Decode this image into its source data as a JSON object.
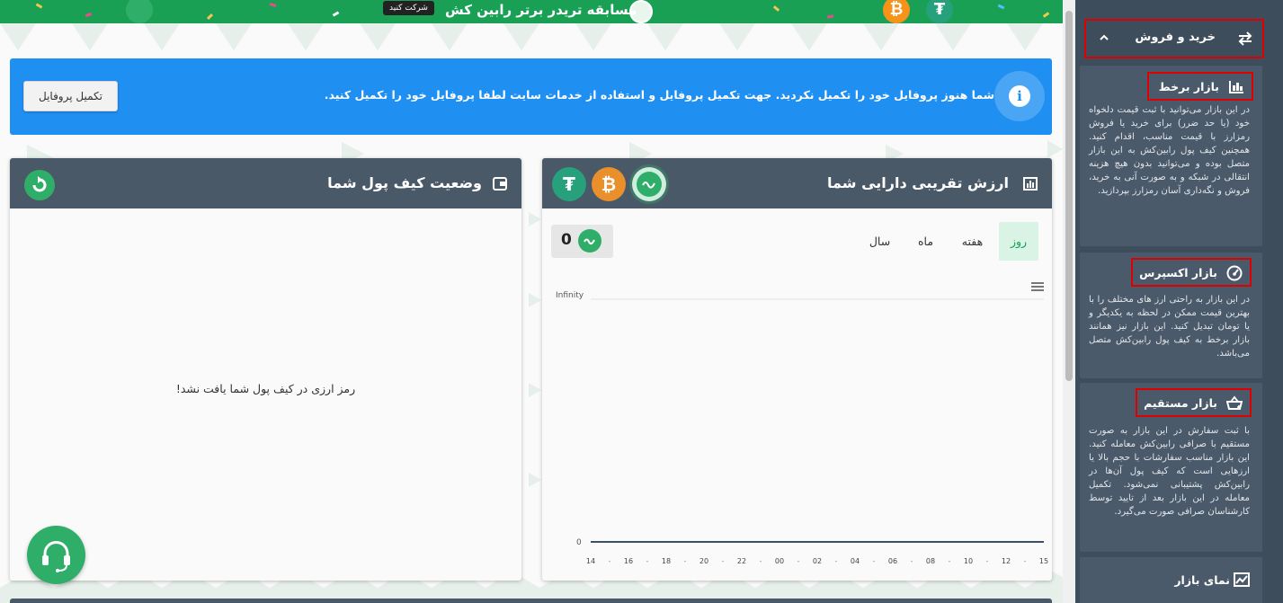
{
  "promo": {
    "title": "مسابقه تریدر برتر رابین کش",
    "join_label": "شرکت کنید"
  },
  "alert": {
    "message": "شما هنوز پروفایل خود را تکمیل نکردید. جهت تکمیل پروفایل و استفاده از خدمات سایت لطفا پروفایل خود را تکمیل کنید.",
    "button_label": "تکمیل پروفایل",
    "icon": "info-icon"
  },
  "wallet": {
    "title": "وضعیت کیف پول شما",
    "empty_message": "رمز ارزی در کیف پول شما یافت نشد!"
  },
  "assets": {
    "title": "ارزش تقریبی دارایی شما",
    "tabs": [
      "روز",
      "هفته",
      "ماه",
      "سال"
    ],
    "active_tab": "روز",
    "value": "0",
    "coins": [
      "toman",
      "bitcoin",
      "tether"
    ]
  },
  "chart_data": {
    "type": "line",
    "x": [
      "14",
      "16",
      "18",
      "20",
      "22",
      "00",
      "02",
      "04",
      "06",
      "08",
      "10",
      "12",
      "15"
    ],
    "y_tick_labels": [
      "Infinity",
      "0"
    ],
    "series": [
      {
        "values": [
          0,
          0,
          0,
          0,
          0,
          0,
          0,
          0,
          0,
          0,
          0,
          0,
          0
        ]
      }
    ],
    "grid": true
  },
  "sidebar": {
    "header": "خرید و فروش",
    "items": [
      {
        "title": "بازار برخط",
        "icon": "bar-chart-icon",
        "description": "در این بازار می‌توانید با ثبت قیمت دلخواه خود (یا حد ضرر) برای خرید یا فروش رمزارز با قیمت مناسب، اقدام کنید. همچنین کیف پول رابین‌کش به این بازار متصل بوده و می‌توانید بدون هیچ هزینه انتقالی در شبکه و به صورت آنی به خرید، فروش و نگه‌داری آسان رمزارز بپردازید."
      },
      {
        "title": "بازار اکسپرس",
        "icon": "speedometer-icon",
        "description": "در این بازار به راحتی ارز های مختلف را با بهترین قیمت ممکن در لحظه به یکدیگر و یا تومان تبدیل کنید. این بازار نیز همانند بازار برخط به کیف پول رابین‌کش متصل می‌باشد."
      },
      {
        "title": "بازار مستقیم",
        "icon": "basket-icon",
        "description": "با ثبت سفارش در این بازار به صورت مستقیم با صرافی رابین‌کش معامله کنید. این بازار مناسب سفارشات با حجم بالا یا ارزهایی است که کیف پول آن‌ها در رابین‌کش پشتیبانی نمی‌شود. تکمیل معامله در این بازار بعد از تایید توسط کارشناسان صرافی صورت می‌گیرد."
      },
      {
        "title": "نمای بازار",
        "icon": "market-view-icon",
        "description": ""
      }
    ]
  },
  "colors": {
    "brand_green": "#19a055",
    "alert_blue": "#1f8ff2",
    "card_header": "#4a5968",
    "sidebar_bg": "#3e4d5c",
    "highlight_red": "#e00000",
    "bitcoin": "#e98f2c",
    "tether": "#26a17b"
  }
}
